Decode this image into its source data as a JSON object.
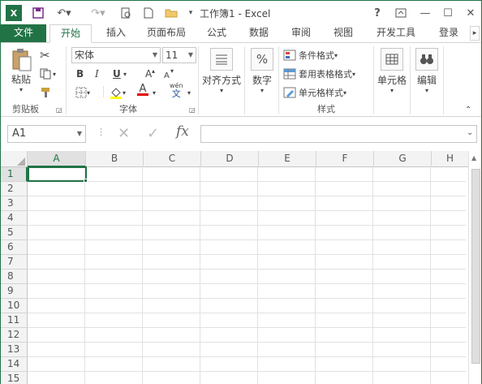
{
  "window": {
    "title": "工作簿1 - Excel",
    "help": "?",
    "minimize": "—",
    "maximize": "☐",
    "close": "✕"
  },
  "tabs": [
    {
      "label": "文件"
    },
    {
      "label": "开始"
    },
    {
      "label": "插入"
    },
    {
      "label": "页面布局"
    },
    {
      "label": "公式"
    },
    {
      "label": "数据"
    },
    {
      "label": "审阅"
    },
    {
      "label": "视图"
    },
    {
      "label": "开发工具"
    },
    {
      "label": "登录"
    }
  ],
  "ribbon": {
    "clipboard": {
      "paste": "粘贴",
      "group": "剪贴板"
    },
    "font": {
      "name": "宋体",
      "size": "11",
      "bold": "B",
      "italic": "I",
      "underline": "U",
      "grow": "A",
      "shrink": "A",
      "fontcolor": "A",
      "phonetic_top": "wén",
      "phonetic_bottom": "文",
      "group": "字体"
    },
    "alignment": {
      "label": "对齐方式"
    },
    "number": {
      "label": "数字",
      "symbol": "%"
    },
    "styles": {
      "cond": "条件格式",
      "table": "套用表格格式",
      "cell": "单元格样式",
      "group": "样式"
    },
    "cells": {
      "label": "单元格"
    },
    "editing": {
      "label": "编辑"
    }
  },
  "formula": {
    "namebox": "A1",
    "fx": "fx",
    "cancel": "✕",
    "enter": "✓"
  },
  "grid": {
    "columns": [
      "A",
      "B",
      "C",
      "D",
      "E",
      "F",
      "G",
      "H"
    ],
    "rows": [
      "1",
      "2",
      "3",
      "4",
      "5",
      "6",
      "7",
      "8",
      "9",
      "10",
      "11",
      "12",
      "13",
      "14",
      "15"
    ],
    "selected": "A1"
  }
}
